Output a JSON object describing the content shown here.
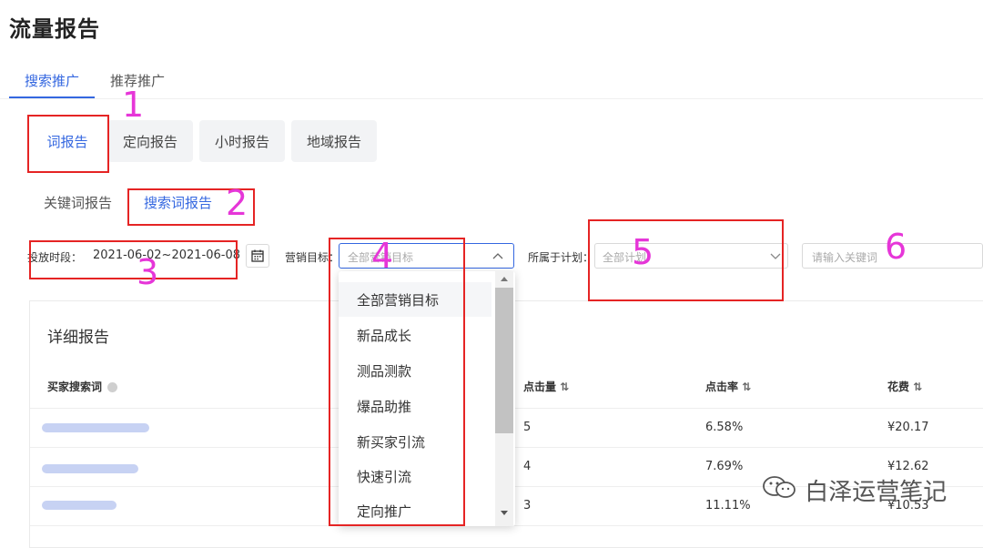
{
  "page": {
    "title": "流量报告"
  },
  "tabs": [
    {
      "label": "搜索推广",
      "active": true
    },
    {
      "label": "推荐推广",
      "active": false
    }
  ],
  "report_types": [
    {
      "label": "词报告",
      "active": true
    },
    {
      "label": "定向报告",
      "active": false
    },
    {
      "label": "小时报告",
      "active": false
    },
    {
      "label": "地域报告",
      "active": false
    }
  ],
  "sub_tabs": [
    {
      "label": "关键词报告",
      "active": false
    },
    {
      "label": "搜索词报告",
      "active": true
    }
  ],
  "filters": {
    "period_label": "投放时段：",
    "period_value": "2021-06-02~2021-06-08",
    "goal_label": "营销目标：",
    "goal_value": "全部营销目标",
    "plan_label": "所属于计划：",
    "plan_value": "全部计划",
    "keyword_placeholder": "请输入关键词"
  },
  "dropdown": {
    "options": [
      "全部营销目标",
      "新品成长",
      "测品测款",
      "爆品助推",
      "新买家引流",
      "快速引流",
      "定向推广"
    ],
    "selected_index": 0
  },
  "details": {
    "title": "详细报告",
    "columns": [
      "买家搜索词",
      "点击量",
      "点击率",
      "花费"
    ],
    "rows": [
      {
        "clicks": "5",
        "ctr": "6.58%",
        "cost": "¥20.17"
      },
      {
        "clicks": "4",
        "ctr": "7.69%",
        "cost": "¥12.62"
      },
      {
        "clicks": "3",
        "ctr": "11.11%",
        "cost": "¥10.53"
      }
    ]
  },
  "annotations": [
    "1",
    "2",
    "3",
    "4",
    "5",
    "6"
  ],
  "watermark": "白泽运营笔记",
  "colors": {
    "accent": "#3467e0",
    "annotation_box": "#e52424",
    "annotation_number": "#e636d8"
  }
}
